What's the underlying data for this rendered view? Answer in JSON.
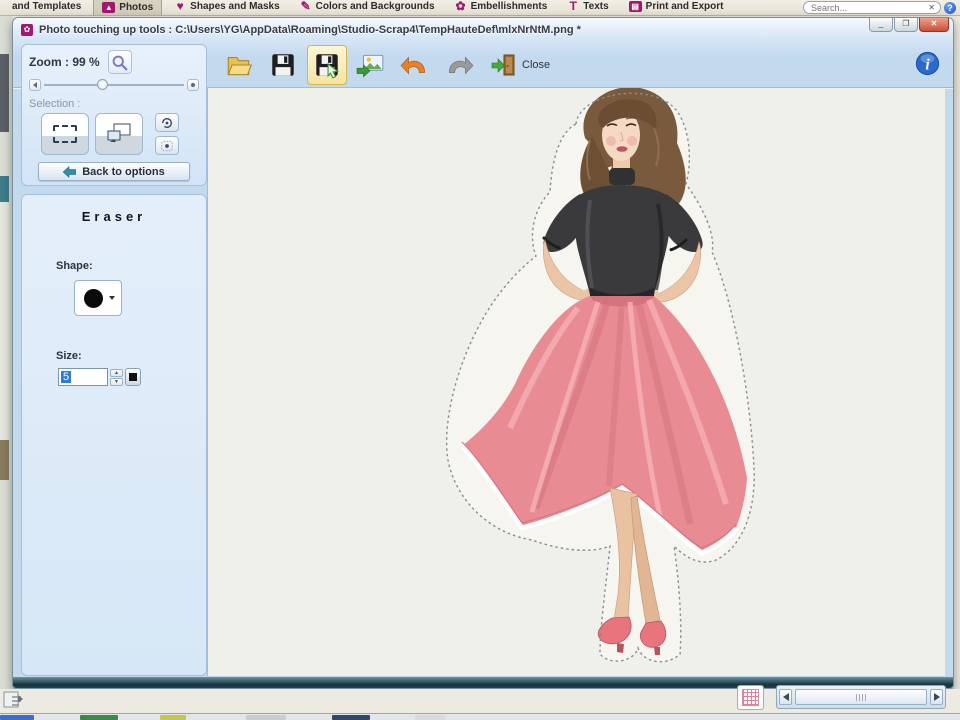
{
  "ribbon": {
    "tabs": [
      "and Templates",
      "Photos",
      "Shapes and Masks",
      "Colors and Backgrounds",
      "Embellishments",
      "Texts",
      "Print and Export"
    ],
    "search_placeholder": "Search..."
  },
  "dialog": {
    "title": "Photo touching up tools : C:\\Users\\YG\\AppData\\Roaming\\Studio-Scrap4\\TempHauteDef\\mlxNrNtM.png *",
    "window_buttons": {
      "minimize": "_",
      "maximize": "❐",
      "close": "✕"
    },
    "toolbar": {
      "close_label": "Close",
      "icons": [
        "open-folder-icon",
        "save-icon",
        "save-as-icon",
        "export-image-icon",
        "undo-icon",
        "redo-icon",
        "exit-door-icon",
        "info-icon"
      ]
    },
    "panel": {
      "zoom_label": "Zoom :  99 %",
      "selection_label": "Selection :",
      "back_label": "Back to options",
      "eraser_title": "Eraser",
      "shape_label": "Shape:",
      "size_label": "Size:",
      "size_value": "5"
    }
  },
  "colors": {
    "brand_magenta": "#a2186e",
    "skirt_coral": "#e88b92",
    "top_black": "#3a3a3c",
    "undo_orange": "#e8802a",
    "info_blue": "#2a6ace",
    "canvas": "#f0f0ea"
  }
}
